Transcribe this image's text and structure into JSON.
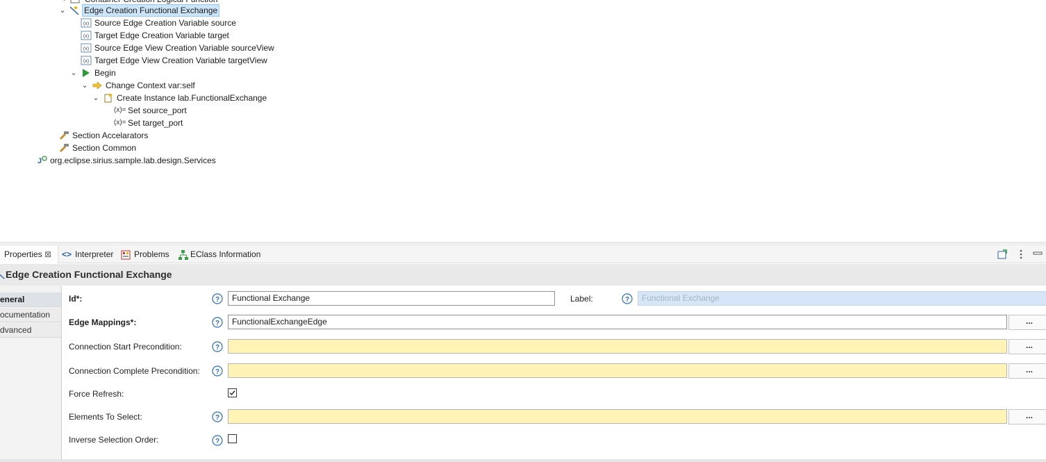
{
  "tree": {
    "items": [
      {
        "label": "Container Creation Logical Function"
      },
      {
        "label": "Edge Creation Functional Exchange"
      },
      {
        "label": "Source Edge Creation Variable source"
      },
      {
        "label": "Target Edge Creation Variable target"
      },
      {
        "label": "Source Edge View Creation Variable sourceView"
      },
      {
        "label": "Target Edge View Creation Variable targetView"
      },
      {
        "label": "Begin"
      },
      {
        "label": "Change Context var:self"
      },
      {
        "label": "Create Instance lab.FunctionalExchange"
      },
      {
        "label": "Set source_port"
      },
      {
        "label": "Set target_port"
      },
      {
        "label": "Section Accelarators"
      },
      {
        "label": "Section Common"
      },
      {
        "label": "org.eclipse.sirius.sample.lab.design.Services"
      }
    ],
    "variable_icon_text": "(x)=",
    "variable_icon_text_alt": "(x)="
  },
  "tabs": [
    {
      "label": "Properties",
      "close": "⊠"
    },
    {
      "label": "Interpreter"
    },
    {
      "label": "Problems"
    },
    {
      "label": "EClass Information"
    }
  ],
  "properties": {
    "title": "Edge Creation Functional Exchange",
    "sections": [
      "General",
      "Documentation",
      "Advanced"
    ],
    "sections_visible": [
      "eneral",
      "ocumentation",
      "dvanced"
    ],
    "fields": {
      "id_label": "Id*:",
      "id_value": "Functional Exchange",
      "label_label": "Label:",
      "label_placeholder": "Functional Exchange",
      "edge_mappings_label": "Edge Mappings*:",
      "edge_mappings_value": "FunctionalExchangeEdge",
      "start_precondition_label": "Connection Start Precondition:",
      "start_precondition_value": "",
      "complete_precondition_label": "Connection Complete Precondition:",
      "complete_precondition_value": "",
      "force_refresh_label": "Force Refresh:",
      "force_refresh_checked": true,
      "elements_to_select_label": "Elements To Select:",
      "elements_to_select_value": "",
      "inverse_selection_label": "Inverse Selection Order:",
      "inverse_selection_checked": false,
      "browse_label": "..."
    }
  },
  "colors": {
    "selection": "#cce4f7",
    "expression_field": "#fff4b6",
    "help_icon": "#2a6fb5"
  }
}
